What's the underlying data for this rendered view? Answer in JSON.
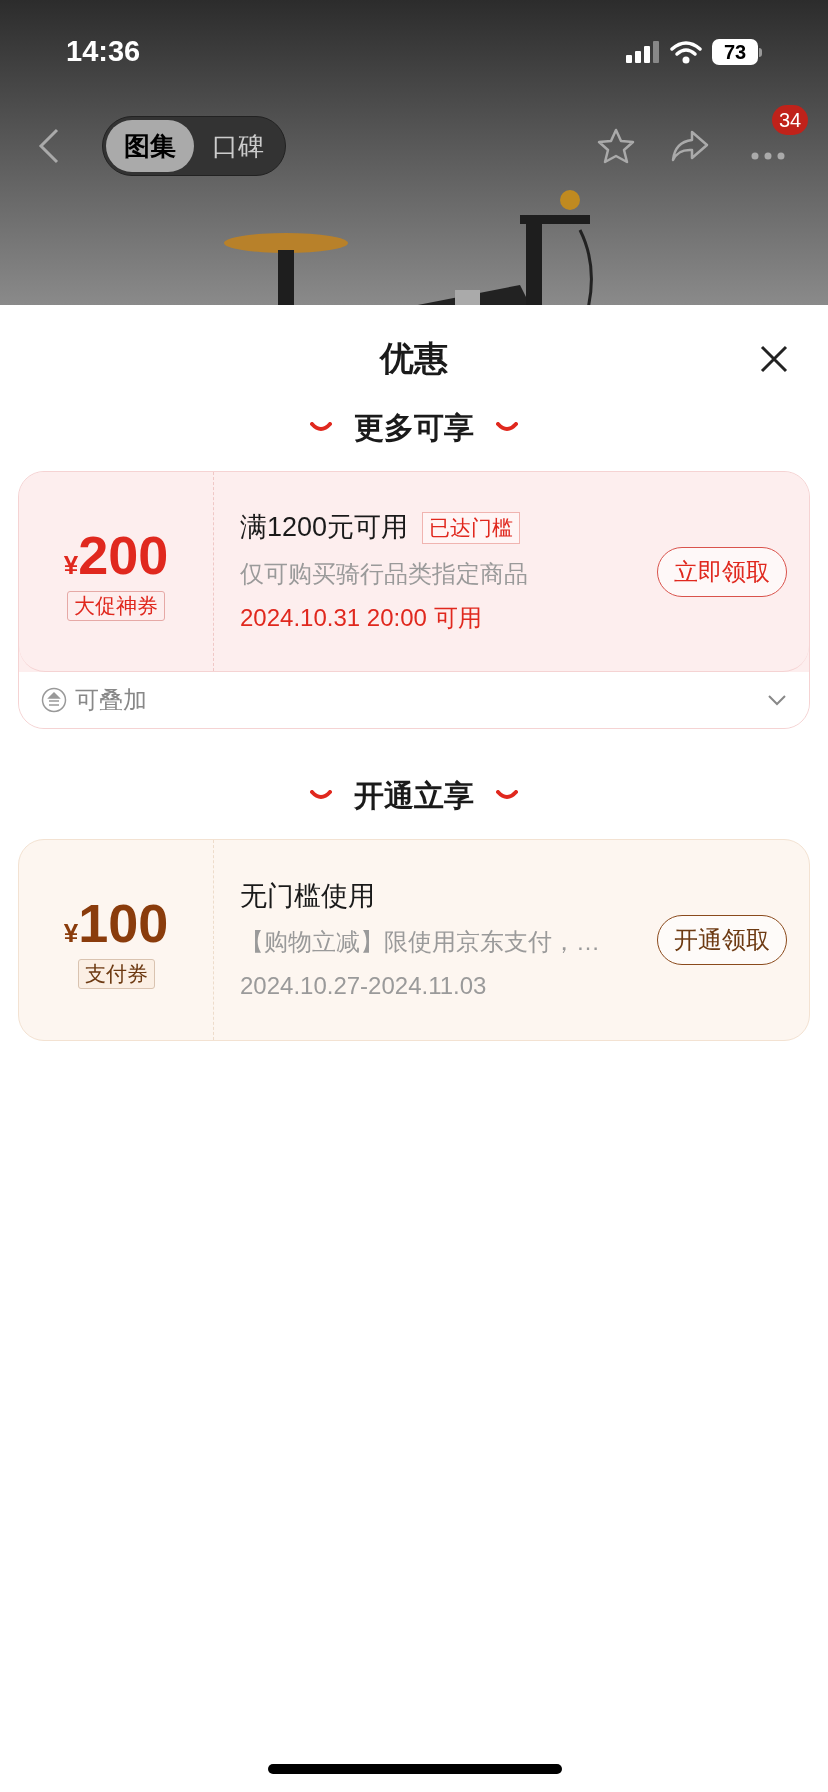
{
  "status_bar": {
    "time": "14:36",
    "battery": "73"
  },
  "nav": {
    "tabs": [
      {
        "label": "图集",
        "selected": true
      },
      {
        "label": "口碑",
        "selected": false
      }
    ],
    "more_badge": "34"
  },
  "sheet": {
    "title": "优惠",
    "sections": [
      {
        "heading": "更多可享",
        "coupons": [
          {
            "kind": "promo",
            "currency": "¥",
            "amount": "200",
            "type_label": "大促神券",
            "title": "满1200元可用",
            "badge": "已达门槛",
            "description": "仅可购买骑行品类指定商品",
            "validity": "2024.10.31 20:00 可用",
            "button": "立即领取",
            "footer": {
              "text": "可叠加",
              "expanded": false
            }
          }
        ]
      },
      {
        "heading": "开通立享",
        "coupons": [
          {
            "kind": "payment",
            "currency": "¥",
            "amount": "100",
            "type_label": "支付券",
            "title": "无门槛使用",
            "description": "【购物立减】限使用京东支付，…",
            "validity": "2024.10.27-2024.11.03",
            "button": "开通领取"
          }
        ]
      }
    ]
  }
}
